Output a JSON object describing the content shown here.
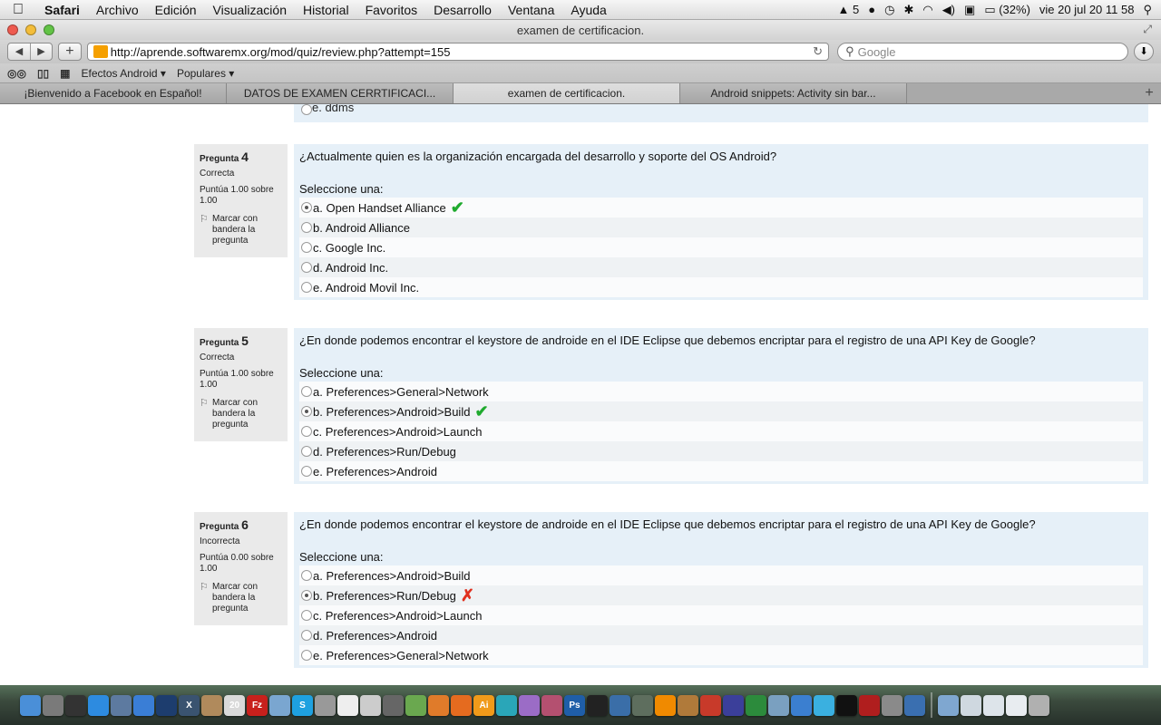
{
  "menubar": {
    "apple": "",
    "items": [
      "Safari",
      "Archivo",
      "Edición",
      "Visualización",
      "Historial",
      "Favoritos",
      "Desarrollo",
      "Ventana",
      "Ayuda"
    ],
    "status": {
      "adobe": "5",
      "battery": "(32%)",
      "clock": "vie 20 jul  20 11 58"
    }
  },
  "window": {
    "title": "examen de certificacion."
  },
  "toolbar": {
    "back": "◀",
    "forward": "▶",
    "new_tab": "+",
    "url": "http://aprende.softwaremx.org/mod/quiz/review.php?attempt=155",
    "reload": "↻",
    "search_placeholder": "Google"
  },
  "bookmarks": {
    "items": [
      "Efectos Android ▾",
      "Populares ▾"
    ]
  },
  "tabs": [
    {
      "label": "¡Bienvenido a Facebook en Español!"
    },
    {
      "label": "DATOS DE EXAMEN CERRTIFICACI..."
    },
    {
      "label": "examen de certificacion."
    },
    {
      "label": "Android snippets: Activity sin bar..."
    }
  ],
  "prev_tail": {
    "text": "e. ddms"
  },
  "questions": [
    {
      "number_prefix": "Pregunta",
      "number": "4",
      "state": "Correcta",
      "grade": "Puntúa 1.00 sobre 1.00",
      "flag": "Marcar con bandera la pregunta",
      "text": "¿Actualmente quien es la organización encargada del desarrollo y soporte del OS Android?",
      "prompt": "Seleccione una:",
      "options": [
        {
          "label": "a. Open Handset Alliance",
          "selected": true,
          "mark": "✔"
        },
        {
          "label": "b. Android Alliance",
          "selected": false,
          "mark": ""
        },
        {
          "label": "c. Google Inc.",
          "selected": false,
          "mark": ""
        },
        {
          "label": "d. Android Inc.",
          "selected": false,
          "mark": ""
        },
        {
          "label": "e. Android Movil Inc.",
          "selected": false,
          "mark": ""
        }
      ]
    },
    {
      "number_prefix": "Pregunta",
      "number": "5",
      "state": "Correcta",
      "grade": "Puntúa 1.00 sobre 1.00",
      "flag": "Marcar con bandera la pregunta",
      "text": "¿En donde podemos encontrar el keystore de androide en el IDE Eclipse que debemos encriptar para el registro de una API Key de Google?",
      "prompt": "Seleccione una:",
      "options": [
        {
          "label": "a. Preferences>General>Network",
          "selected": false,
          "mark": ""
        },
        {
          "label": "b. Preferences>Android>Build",
          "selected": true,
          "mark": "✔"
        },
        {
          "label": "c. Preferences>Android>Launch",
          "selected": false,
          "mark": ""
        },
        {
          "label": "d. Preferences>Run/Debug",
          "selected": false,
          "mark": ""
        },
        {
          "label": "e. Preferences>Android",
          "selected": false,
          "mark": ""
        }
      ]
    },
    {
      "number_prefix": "Pregunta",
      "number": "6",
      "state": "Incorrecta",
      "grade": "Puntúa 0.00 sobre 1.00",
      "flag": "Marcar con bandera la pregunta",
      "text": "¿En donde podemos encontrar el keystore de androide en el IDE Eclipse que debemos encriptar para el registro de una API Key de Google?",
      "prompt": "Seleccione una:",
      "options": [
        {
          "label": "a. Preferences>Android>Build",
          "selected": false,
          "mark": ""
        },
        {
          "label": "b. Preferences>Run/Debug",
          "selected": true,
          "mark": "✗"
        },
        {
          "label": "c. Preferences>Android>Launch",
          "selected": false,
          "mark": ""
        },
        {
          "label": "d. Preferences>Android",
          "selected": false,
          "mark": ""
        },
        {
          "label": "e. Preferences>General>Network",
          "selected": false,
          "mark": ""
        }
      ]
    }
  ],
  "dock": {
    "apps": [
      {
        "name": "finder",
        "color": "#4a8fd8",
        "glyph": ""
      },
      {
        "name": "launchpad",
        "color": "#7a7a7a",
        "glyph": ""
      },
      {
        "name": "dashboard",
        "color": "#333333",
        "glyph": ""
      },
      {
        "name": "app-store",
        "color": "#2d8be0",
        "glyph": ""
      },
      {
        "name": "preview",
        "color": "#5d7aa0",
        "glyph": ""
      },
      {
        "name": "safari",
        "color": "#3a7ed6",
        "glyph": ""
      },
      {
        "name": "quicktime",
        "color": "#1d3d6e",
        "glyph": ""
      },
      {
        "name": "x11",
        "color": "#3a5370",
        "glyph": "X"
      },
      {
        "name": "address-book",
        "color": "#b08a5c",
        "glyph": ""
      },
      {
        "name": "ical",
        "color": "#d9d9d9",
        "glyph": "20"
      },
      {
        "name": "filezilla",
        "color": "#c8201c",
        "glyph": "Fz"
      },
      {
        "name": "virtual-box-3d",
        "color": "#7aa6d0",
        "glyph": ""
      },
      {
        "name": "skype",
        "color": "#1ea1e0",
        "glyph": "S"
      },
      {
        "name": "utility",
        "color": "#999999",
        "glyph": ""
      },
      {
        "name": "textedit",
        "color": "#eeeeee",
        "glyph": ""
      },
      {
        "name": "document",
        "color": "#cccccc",
        "glyph": ""
      },
      {
        "name": "calculator",
        "color": "#666666",
        "glyph": ""
      },
      {
        "name": "android-sdk",
        "color": "#6aa84f",
        "glyph": ""
      },
      {
        "name": "blender",
        "color": "#e07b2a",
        "glyph": ""
      },
      {
        "name": "firefox",
        "color": "#e56b1f",
        "glyph": ""
      },
      {
        "name": "illustrator",
        "color": "#f09a1a",
        "glyph": "Ai"
      },
      {
        "name": "network",
        "color": "#2aa6b8",
        "glyph": ""
      },
      {
        "name": "app-1",
        "color": "#9b6cc6",
        "glyph": ""
      },
      {
        "name": "app-2",
        "color": "#b45070",
        "glyph": ""
      },
      {
        "name": "photoshop",
        "color": "#1f5ea8",
        "glyph": "Ps"
      },
      {
        "name": "unity",
        "color": "#222222",
        "glyph": ""
      },
      {
        "name": "virtualbox",
        "color": "#3a6ea8",
        "glyph": ""
      },
      {
        "name": "app-3",
        "color": "#5e6e5e",
        "glyph": ""
      },
      {
        "name": "vlc",
        "color": "#f08a00",
        "glyph": ""
      },
      {
        "name": "app-4",
        "color": "#b07a3a",
        "glyph": ""
      },
      {
        "name": "angry-birds",
        "color": "#c83a2a",
        "glyph": ""
      },
      {
        "name": "eclipse",
        "color": "#3b3f9a",
        "glyph": ""
      },
      {
        "name": "app-5",
        "color": "#2c8b3c",
        "glyph": ""
      },
      {
        "name": "monitor",
        "color": "#7aa0c0",
        "glyph": ""
      },
      {
        "name": "itunes",
        "color": "#3b7fd0",
        "glyph": ""
      },
      {
        "name": "twitter",
        "color": "#3ab0e0",
        "glyph": ""
      },
      {
        "name": "terminal",
        "color": "#111111",
        "glyph": ""
      },
      {
        "name": "photo-booth",
        "color": "#b01e1e",
        "glyph": ""
      },
      {
        "name": "system-preferences",
        "color": "#8a8a8a",
        "glyph": ""
      },
      {
        "name": "xcode",
        "color": "#3a6fb0",
        "glyph": ""
      },
      {
        "name": "folder-applications",
        "color": "#7fa7d0",
        "glyph": ""
      },
      {
        "name": "folder-documents",
        "color": "#cfd8e0",
        "glyph": ""
      },
      {
        "name": "folder-downloads",
        "color": "#dde4ea",
        "glyph": ""
      },
      {
        "name": "folder-3",
        "color": "#e8ecf0",
        "glyph": ""
      },
      {
        "name": "trash",
        "color": "#b0b0b0",
        "glyph": ""
      }
    ]
  }
}
